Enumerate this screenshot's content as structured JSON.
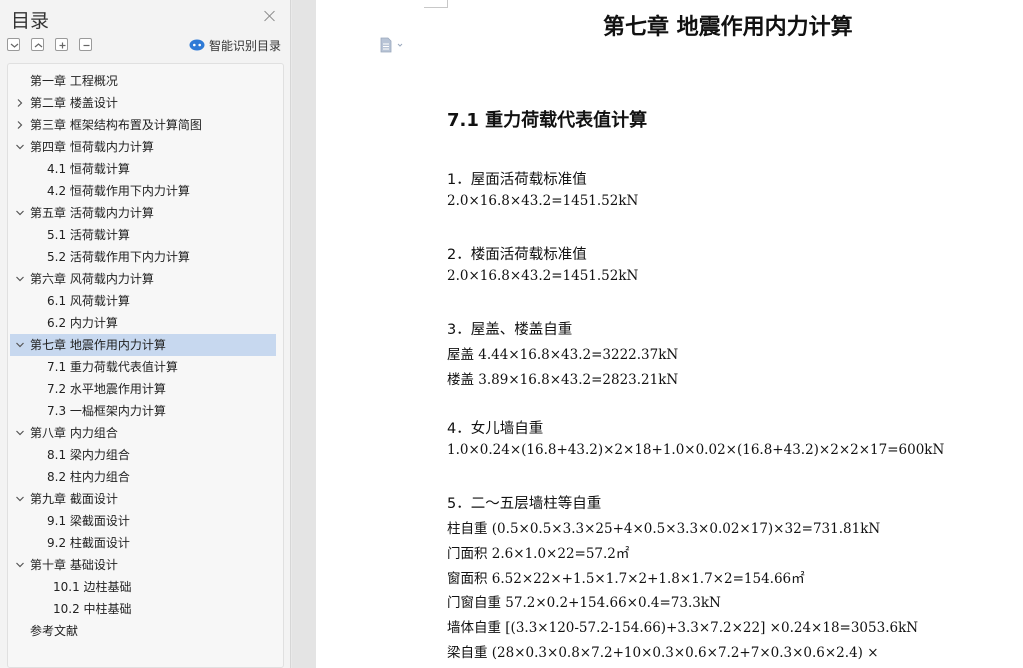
{
  "toc": {
    "title": "目录",
    "smart_label": "智能识别目录",
    "tool_buttons": [
      "expand-all",
      "collapse-all",
      "add-heading",
      "remove-heading"
    ],
    "items": [
      {
        "label": "第一章  工程概况",
        "level": 1,
        "chevron": "none",
        "selected": false
      },
      {
        "label": "第二章  楼盖设计",
        "level": 1,
        "chevron": "right",
        "selected": false
      },
      {
        "label": "第三章  框架结构布置及计算简图",
        "level": 1,
        "chevron": "right",
        "selected": false
      },
      {
        "label": "第四章  恒荷载内力计算",
        "level": 1,
        "chevron": "down",
        "selected": false
      },
      {
        "label": "4.1  恒荷载计算",
        "level": 2,
        "chevron": "none",
        "selected": false
      },
      {
        "label": "4.2  恒荷载作用下内力计算",
        "level": 2,
        "chevron": "none",
        "selected": false
      },
      {
        "label": "第五章  活荷载内力计算",
        "level": 1,
        "chevron": "down",
        "selected": false
      },
      {
        "label": "5.1  活荷载计算",
        "level": 2,
        "chevron": "none",
        "selected": false
      },
      {
        "label": "5.2  活荷载作用下内力计算",
        "level": 2,
        "chevron": "none",
        "selected": false
      },
      {
        "label": "第六章  风荷载内力计算",
        "level": 1,
        "chevron": "down",
        "selected": false
      },
      {
        "label": "6.1  风荷载计算",
        "level": 2,
        "chevron": "none",
        "selected": false
      },
      {
        "label": "6.2  内力计算",
        "level": 2,
        "chevron": "none",
        "selected": false
      },
      {
        "label": "第七章  地震作用内力计算",
        "level": 1,
        "chevron": "down",
        "selected": true
      },
      {
        "label": "7.1  重力荷载代表值计算",
        "level": 2,
        "chevron": "none",
        "selected": false
      },
      {
        "label": "7.2  水平地震作用计算",
        "level": 2,
        "chevron": "none",
        "selected": false
      },
      {
        "label": "7.3  一榀框架内力计算",
        "level": 2,
        "chevron": "none",
        "selected": false
      },
      {
        "label": "第八章  内力组合",
        "level": 1,
        "chevron": "down",
        "selected": false
      },
      {
        "label": "8.1  梁内力组合",
        "level": 2,
        "chevron": "none",
        "selected": false
      },
      {
        "label": "8.2  柱内力组合",
        "level": 2,
        "chevron": "none",
        "selected": false
      },
      {
        "label": "第九章  截面设计",
        "level": 1,
        "chevron": "down",
        "selected": false
      },
      {
        "label": "9.1  梁截面设计",
        "level": 2,
        "chevron": "none",
        "selected": false
      },
      {
        "label": "9.2  柱截面设计",
        "level": 2,
        "chevron": "none",
        "selected": false
      },
      {
        "label": "第十章  基础设计",
        "level": 1,
        "chevron": "down",
        "selected": false
      },
      {
        "label": "10.1  边柱基础",
        "level": 2,
        "chevron": "none",
        "selected": false
      },
      {
        "label": "10.2  中柱基础",
        "level": 2,
        "chevron": "none",
        "selected": false
      },
      {
        "label": "参考文献",
        "level": 1,
        "chevron": "none",
        "selected": false
      }
    ]
  },
  "document": {
    "chapter_title": "第七章  地震作用内力计算",
    "section_title": "7.1  重力荷载代表值计算",
    "blocks": [
      {
        "heading": "1．屋面活荷载标准值",
        "lines": [
          "2.0×16.8×43.2=1451.52kN"
        ]
      },
      {
        "heading": "2．楼面活荷载标准值",
        "lines": [
          "2.0×16.8×43.2=1451.52kN"
        ]
      },
      {
        "heading": "3．屋盖、楼盖自重",
        "lines": [
          "屋盖 4.44×16.8×43.2=3222.37kN",
          "楼盖 3.89×16.8×43.2=2823.21kN"
        ]
      },
      {
        "heading": "4．女儿墙自重",
        "lines": [
          "1.0×0.24×(16.8+43.2)×2×18+1.0×0.02×(16.8+43.2)×2×2×17=600kN"
        ]
      },
      {
        "heading": "5．二～五层墙柱等自重",
        "lines": [
          "柱自重 (0.5×0.5×3.3×25+4×0.5×3.3×0.02×17)×32=731.81kN",
          "门面积 2.6×1.0×22=57.2㎡",
          "窗面积 6.52×22×+1.5×1.7×2+1.8×1.7×2=154.66㎡",
          "门窗自重 57.2×0.2+154.66×0.4=73.3kN",
          "墙体自重 [(3.3×120-57.2-154.66)+3.3×7.2×22] ×0.24×18=3053.6kN",
          "梁自重  (28×0.3×0.8×7.2+10×0.3×0.6×7.2+7×0.3×0.6×2.4) ×"
        ]
      }
    ]
  },
  "colors": {
    "pane_bg": "#f3f3f3",
    "selected_bg": "#c7d8ef",
    "page_bg": "#ffffff",
    "gap_bg": "#e4e4e4",
    "smart_icon_blue": "#2f7ad6"
  }
}
